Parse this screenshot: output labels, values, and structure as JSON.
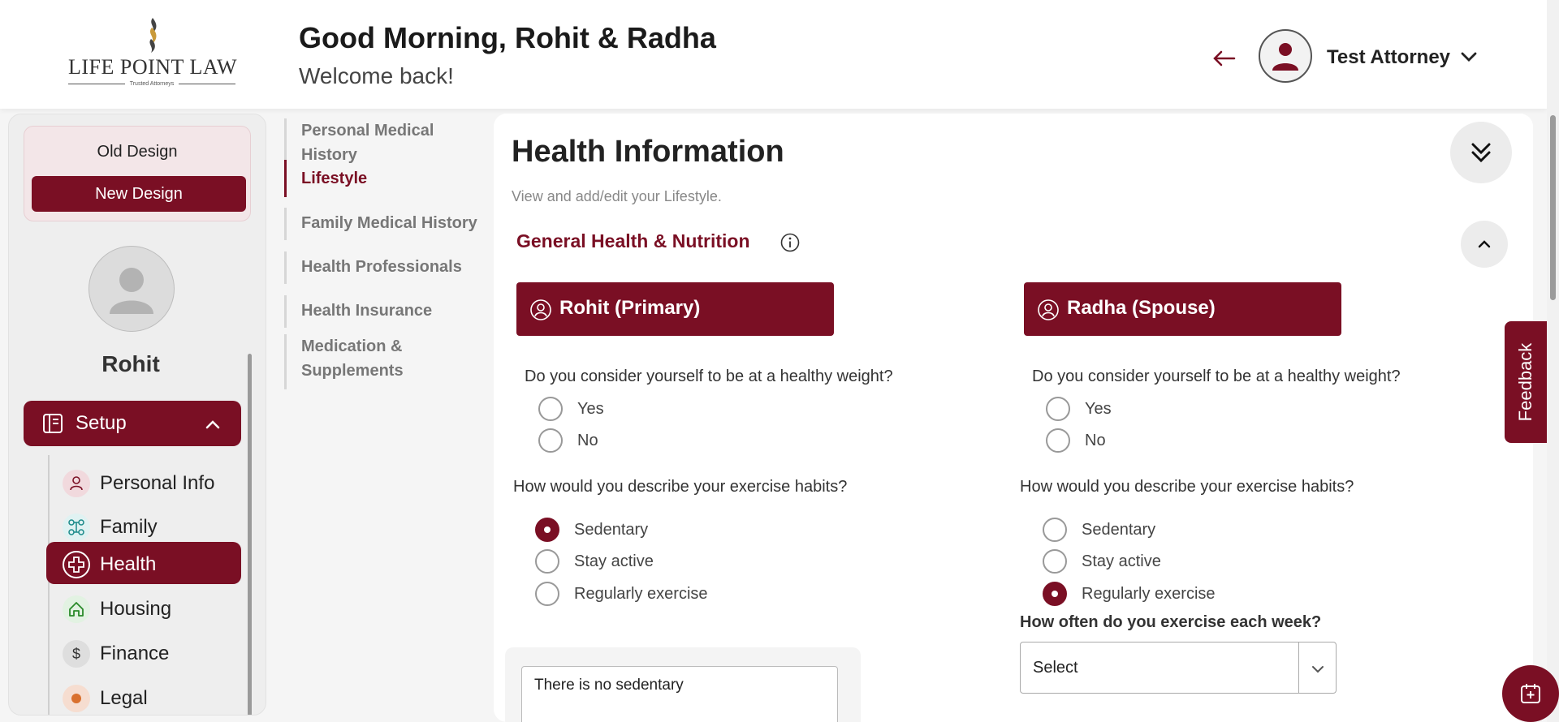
{
  "header": {
    "logo": {
      "brand": "LIFE POINT LAW",
      "tagline": "Trusted Attorneys"
    },
    "greeting": "Good Morning, Rohit & Radha",
    "subgreeting": "Welcome back!",
    "user_name": "Test Attorney",
    "icons": {
      "back": "arrow-left-icon",
      "avatar": "user-avatar-icon",
      "dropdown": "chevron-down-icon"
    }
  },
  "sidebar": {
    "old_design": "Old Design",
    "new_design": "New Design",
    "profile_name": "Rohit",
    "setup_label": "Setup",
    "items": [
      {
        "label": "Personal Info",
        "icon": "person-icon"
      },
      {
        "label": "Family",
        "icon": "family-tree-icon"
      },
      {
        "label": "Health",
        "icon": "medical-cross-icon",
        "active": true
      },
      {
        "label": "Housing",
        "icon": "house-icon"
      },
      {
        "label": "Finance",
        "icon": "dollar-icon"
      },
      {
        "label": "Legal",
        "icon": "legal-icon"
      }
    ]
  },
  "subnav": {
    "items": [
      {
        "label": "Personal Medical History"
      },
      {
        "label": "Lifestyle",
        "active": true
      },
      {
        "label": "Family Medical History"
      },
      {
        "label": "Health Professionals"
      },
      {
        "label": "Health Insurance"
      },
      {
        "label": "Medication & Supplements"
      }
    ]
  },
  "main": {
    "title": "Health Information",
    "subtitle": "View and add/edit your Lifestyle.",
    "section_title": "General Health & Nutrition",
    "primary": {
      "name": "Rohit (Primary)",
      "q_weight": "Do you consider yourself to be at a healthy weight?",
      "weight_options": [
        "Yes",
        "No"
      ],
      "weight_selected": null,
      "q_exercise": "How would you describe your exercise habits?",
      "exercise_options": [
        "Sedentary",
        "Stay active",
        "Regularly exercise"
      ],
      "exercise_selected": "Sedentary",
      "explain_value": "There is no sedentary"
    },
    "spouse": {
      "name": "Radha (Spouse)",
      "q_weight": "Do you consider yourself to be at a healthy weight?",
      "weight_options": [
        "Yes",
        "No"
      ],
      "weight_selected": null,
      "q_exercise": "How would you describe your exercise habits?",
      "exercise_options": [
        "Sedentary",
        "Stay active",
        "Regularly exercise"
      ],
      "exercise_selected": "Regularly exercise",
      "q_frequency": "How often do you exercise each week?",
      "frequency_value": "Select"
    }
  },
  "feedback_label": "Feedback",
  "colors": {
    "brand": "#7a0f24",
    "background": "#f5f5f5"
  }
}
